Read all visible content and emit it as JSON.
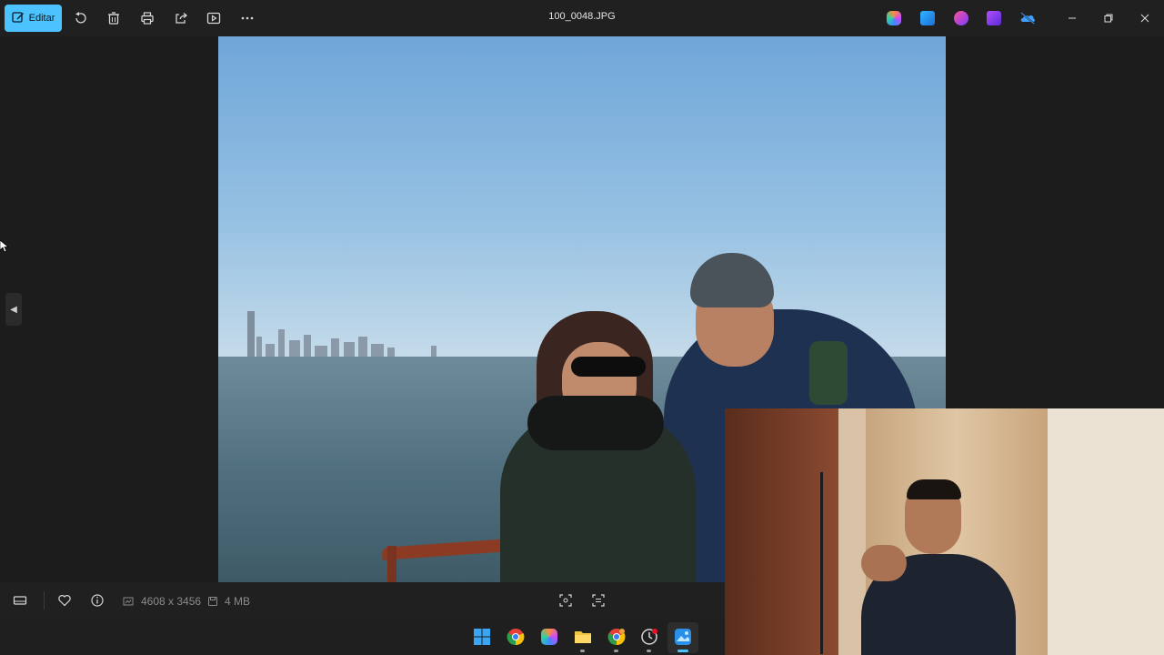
{
  "toolbar": {
    "edit_label": "Editar",
    "title": "100_0048.JPG"
  },
  "footer": {
    "dimensions": "4608 x 3456",
    "size": "4 MB"
  },
  "icons": {
    "edit": "edit-icon",
    "rotate": "rotate-icon",
    "delete": "trash-icon",
    "print": "print-icon",
    "share": "share-icon",
    "slideshow": "slideshow-icon",
    "more": "more-icon",
    "minimize": "minimize-icon",
    "restore": "restore-icon",
    "close": "close-icon"
  },
  "colors": {
    "accent": "#4cc2ff",
    "background": "#1c1c1c",
    "toolbar": "#202020"
  }
}
